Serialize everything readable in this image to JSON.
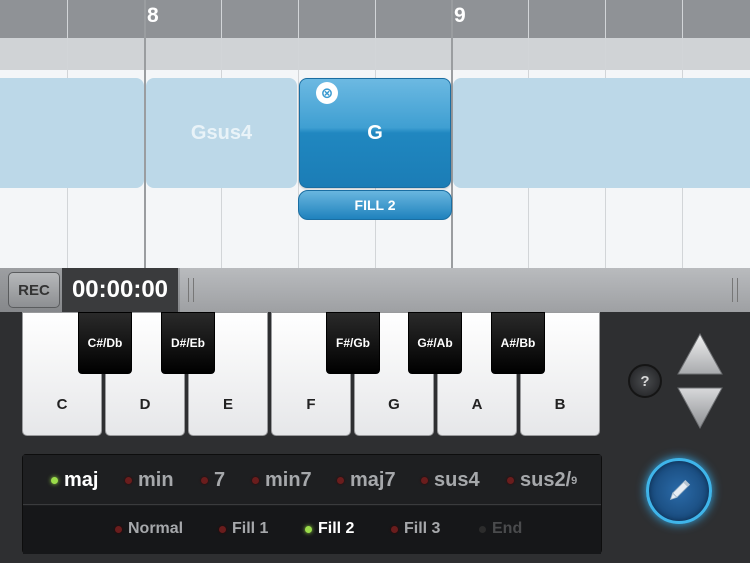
{
  "timeline": {
    "bar_numbers": [
      "8",
      "9"
    ],
    "chords": [
      {
        "label": "",
        "state": "inactive"
      },
      {
        "label": "Gsus4",
        "state": "inactive"
      },
      {
        "label": "G",
        "state": "active"
      },
      {
        "label": "",
        "state": "inactive"
      }
    ],
    "active_fill_tag": "FILL 2",
    "close_glyph": "⊗"
  },
  "transport": {
    "rec_label": "REC",
    "time": "00:00:00"
  },
  "keyboard": {
    "white_keys": [
      "C",
      "D",
      "E",
      "F",
      "G",
      "A",
      "B"
    ],
    "black_keys": [
      "C#/Db",
      "D#/Eb",
      "F#/Gb",
      "G#/Ab",
      "A#/Bb"
    ]
  },
  "controls": {
    "help_label": "?",
    "icons": [
      "arrow-up-icon",
      "arrow-down-icon",
      "pencil-icon"
    ]
  },
  "chord_types": {
    "items": [
      {
        "label": "maj",
        "selected": true
      },
      {
        "label": "min",
        "selected": false
      },
      {
        "label": "7",
        "selected": false
      },
      {
        "label": "min7",
        "selected": false
      },
      {
        "label": "maj7",
        "selected": false
      },
      {
        "label": "sus4",
        "selected": false
      },
      {
        "label": "sus2/",
        "sup": "9",
        "selected": false
      }
    ]
  },
  "fills": {
    "items": [
      {
        "label": "Normal",
        "selected": false
      },
      {
        "label": "Fill 1",
        "selected": false
      },
      {
        "label": "Fill 2",
        "selected": true
      },
      {
        "label": "Fill 3",
        "selected": false
      },
      {
        "label": "End",
        "selected": false,
        "disabled": true
      }
    ]
  },
  "colors": {
    "accent_blue": "#2087c0",
    "indicator_on": "#9bdc4a",
    "indicator_off": "#6a1d1d"
  }
}
